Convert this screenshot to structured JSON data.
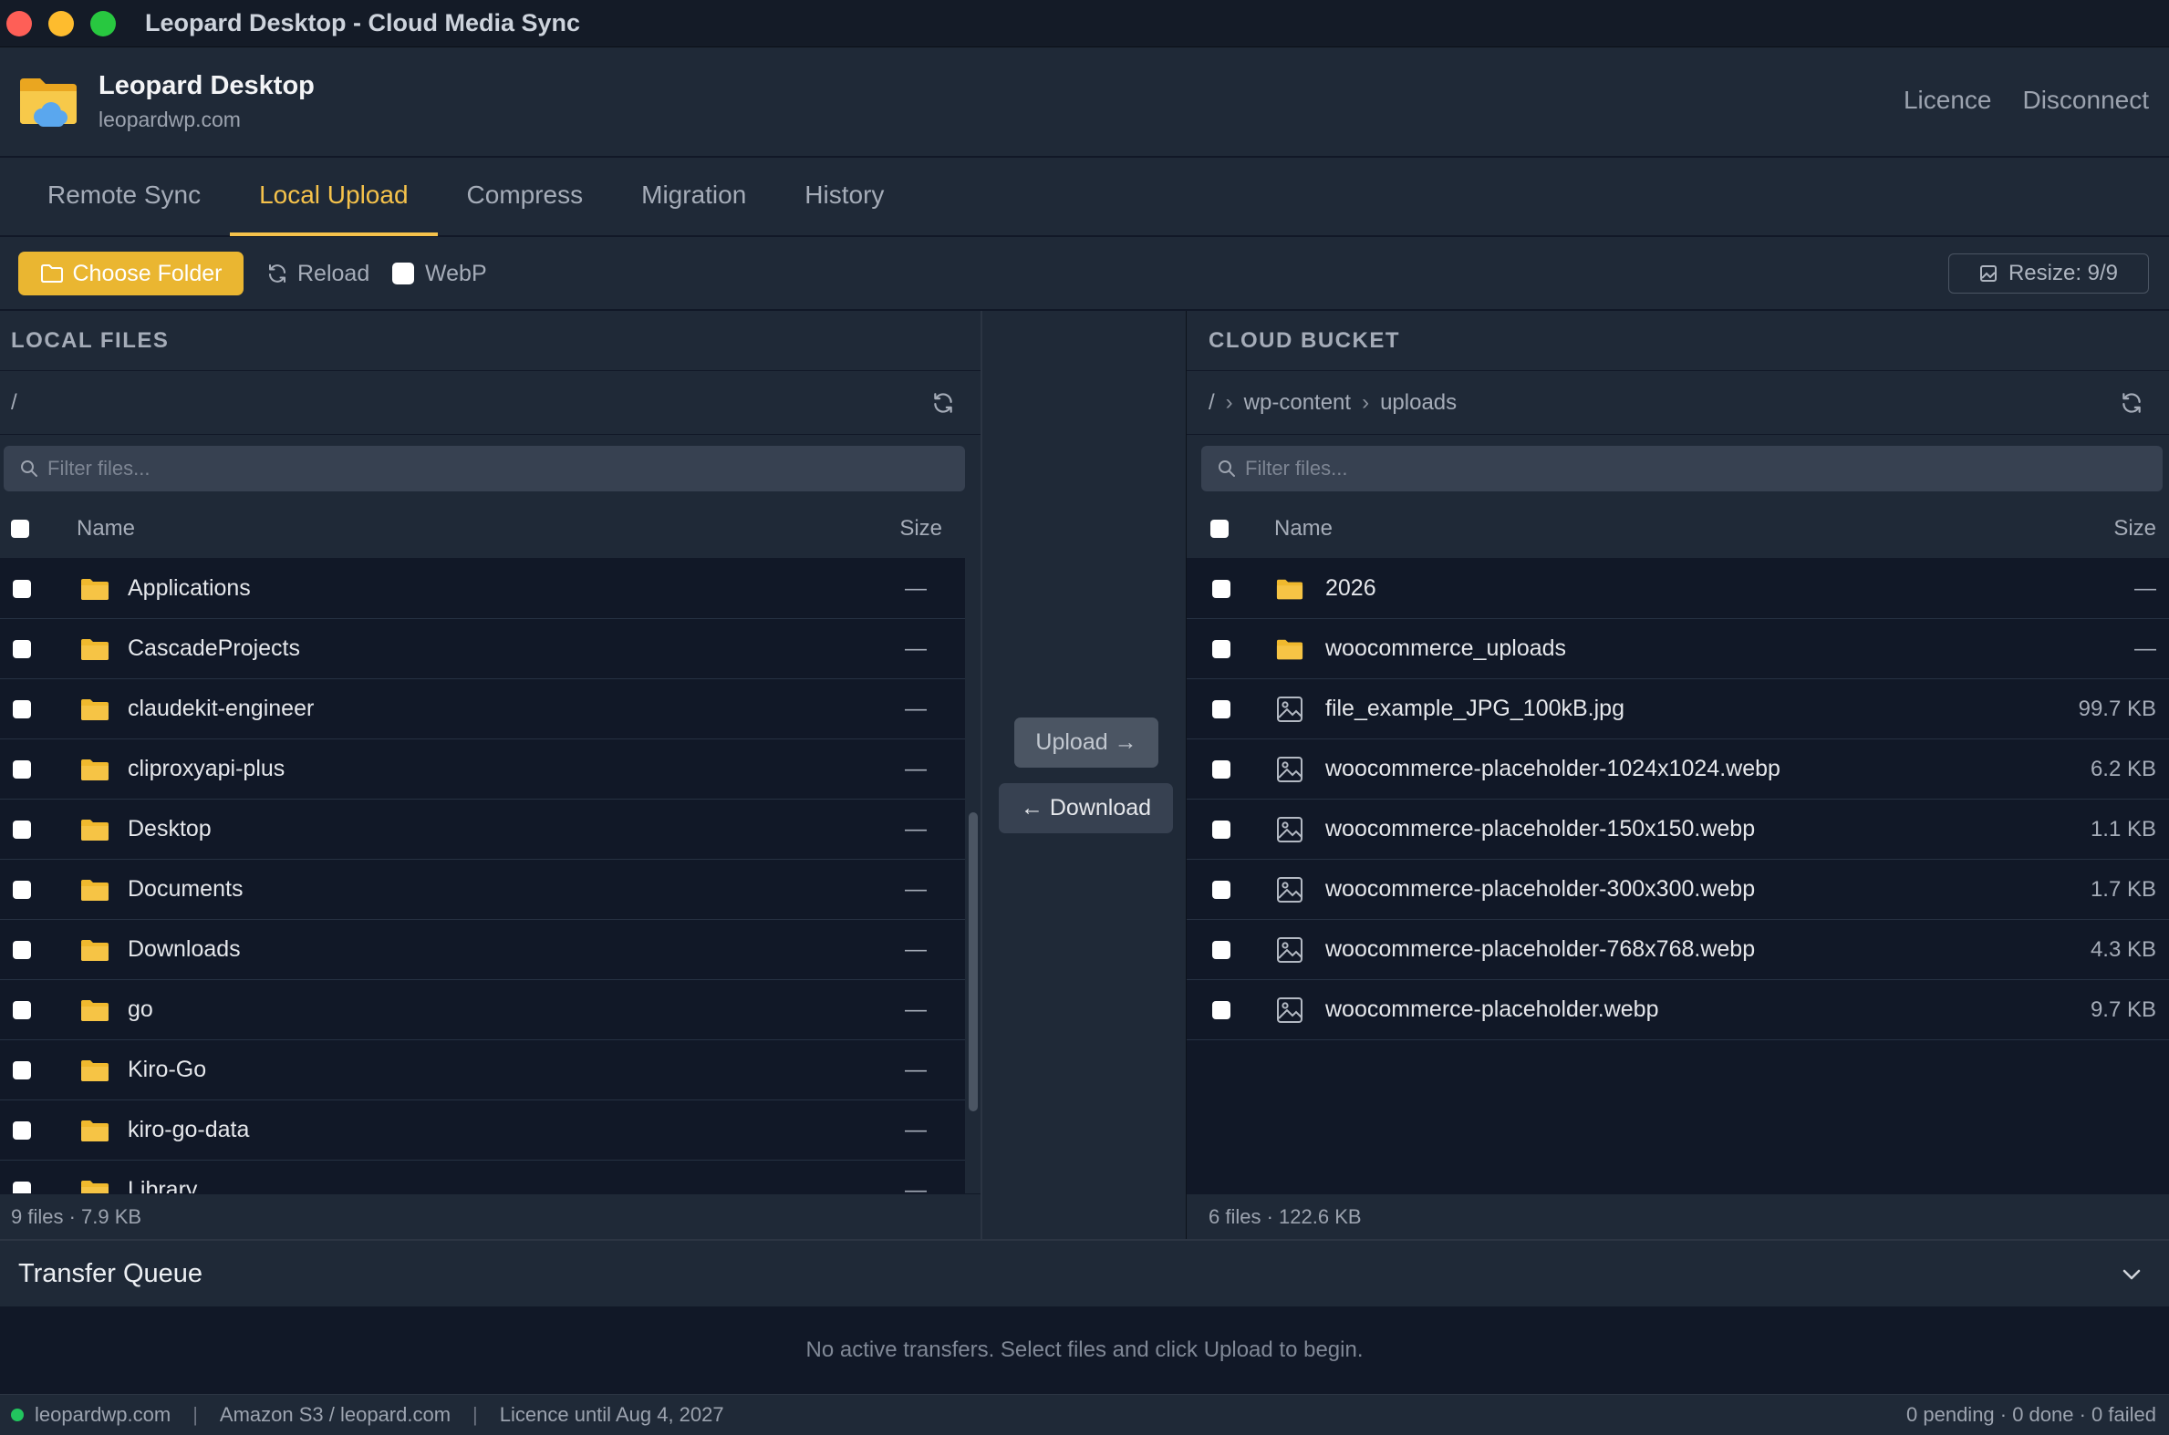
{
  "window": {
    "title": "Leopard Desktop - Cloud Media Sync"
  },
  "header": {
    "app_name": "Leopard Desktop",
    "domain": "leopardwp.com",
    "links": [
      "Licence",
      "Disconnect"
    ]
  },
  "tabs": [
    {
      "label": "Remote Sync",
      "active": false
    },
    {
      "label": "Local Upload",
      "active": true
    },
    {
      "label": "Compress",
      "active": false
    },
    {
      "label": "Migration",
      "active": false
    },
    {
      "label": "History",
      "active": false
    }
  ],
  "toolbar": {
    "choose_folder": "Choose Folder",
    "reload": "Reload",
    "webp": "WebP",
    "resize": "Resize: 9/9"
  },
  "local": {
    "title": "LOCAL FILES",
    "path": "/",
    "filter_placeholder": "Filter files...",
    "col_name": "Name",
    "col_size": "Size",
    "rows": [
      {
        "name": "Applications",
        "size": "—",
        "icon": "folder-icon"
      },
      {
        "name": "CascadeProjects",
        "size": "—",
        "icon": "folder-icon"
      },
      {
        "name": "claudekit-engineer",
        "size": "—",
        "icon": "folder-icon"
      },
      {
        "name": "cliproxyapi-plus",
        "size": "—",
        "icon": "folder-icon"
      },
      {
        "name": "Desktop",
        "size": "—",
        "icon": "folder-icon"
      },
      {
        "name": "Documents",
        "size": "—",
        "icon": "folder-icon"
      },
      {
        "name": "Downloads",
        "size": "—",
        "icon": "folder-icon"
      },
      {
        "name": "go",
        "size": "—",
        "icon": "folder-icon"
      },
      {
        "name": "Kiro-Go",
        "size": "—",
        "icon": "folder-icon"
      },
      {
        "name": "kiro-go-data",
        "size": "—",
        "icon": "folder-icon"
      },
      {
        "name": "Library",
        "size": "—",
        "icon": "folder-icon"
      }
    ],
    "footer": "9 files · 7.9 KB"
  },
  "transfer": {
    "upload": "Upload →",
    "download": "← Download"
  },
  "cloud": {
    "title": "CLOUD BUCKET",
    "breadcrumb": [
      "/",
      "wp-content",
      "uploads"
    ],
    "filter_placeholder": "Filter files...",
    "col_name": "Name",
    "col_size": "Size",
    "rows": [
      {
        "name": "2026",
        "size": "—",
        "icon": "folder-icon"
      },
      {
        "name": "woocommerce_uploads",
        "size": "—",
        "icon": "folder-icon"
      },
      {
        "name": "file_example_JPG_100kB.jpg",
        "size": "99.7 KB",
        "icon": "image-file-icon"
      },
      {
        "name": "woocommerce-placeholder-1024x1024.webp",
        "size": "6.2 KB",
        "icon": "image-file-icon"
      },
      {
        "name": "woocommerce-placeholder-150x150.webp",
        "size": "1.1 KB",
        "icon": "image-file-icon"
      },
      {
        "name": "woocommerce-placeholder-300x300.webp",
        "size": "1.7 KB",
        "icon": "image-file-icon"
      },
      {
        "name": "woocommerce-placeholder-768x768.webp",
        "size": "4.3 KB",
        "icon": "image-file-icon"
      },
      {
        "name": "woocommerce-placeholder.webp",
        "size": "9.7 KB",
        "icon": "image-file-icon"
      }
    ],
    "footer": "6 files · 122.6 KB"
  },
  "queue": {
    "title": "Transfer Queue",
    "empty": "No active transfers. Select files and click Upload to begin."
  },
  "status": {
    "site": "leopardwp.com",
    "storage": "Amazon S3 / leopard.com",
    "licence": "Licence until Aug 4, 2027",
    "counts": "0 pending · 0 done · 0 failed"
  },
  "colors": {
    "accent": "#eab631",
    "tab_active": "#f5c24b",
    "folder": "#f0b92e",
    "connected": "#22c55e"
  }
}
